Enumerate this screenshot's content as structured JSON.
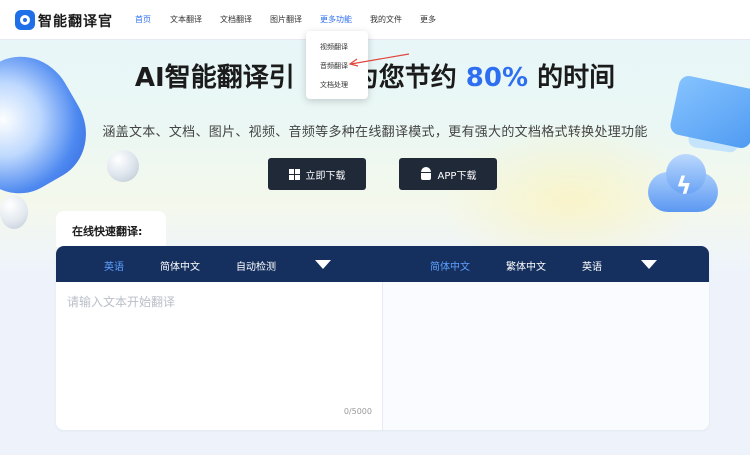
{
  "nav": {
    "logo_text": "智能翻译官",
    "items": [
      {
        "label": "首页"
      },
      {
        "label": "文本翻译"
      },
      {
        "label": "文档翻译"
      },
      {
        "label": "图片翻译"
      },
      {
        "label": "更多功能"
      },
      {
        "label": "我的文件"
      },
      {
        "label": "更多"
      }
    ]
  },
  "dropdown": {
    "items": [
      {
        "label": "视频翻译"
      },
      {
        "label": "音频翻译"
      },
      {
        "label": "文档处理"
      }
    ]
  },
  "hero": {
    "title_pre": "AI智能翻译引",
    "title_mid": "为您节约",
    "title_pct": "80%",
    "title_post": "的时间",
    "subtitle": "涵盖文本、文档、图片、视频、音频等多种在线翻译模式，更有强大的文档格式转换处理功能",
    "btn_download": "立即下载",
    "btn_app": "APP下载"
  },
  "quick": {
    "tab_label": "在线快速翻译:",
    "source_langs": [
      "英语",
      "简体中文",
      "自动检测"
    ],
    "target_langs": [
      "简体中文",
      "繁体中文",
      "英语"
    ],
    "placeholder": "请输入文本开始翻译",
    "counter": "0/5000"
  },
  "colors": {
    "accent": "#2d6ff0",
    "lang_bar": "#15305f",
    "button_bg": "#202938"
  }
}
